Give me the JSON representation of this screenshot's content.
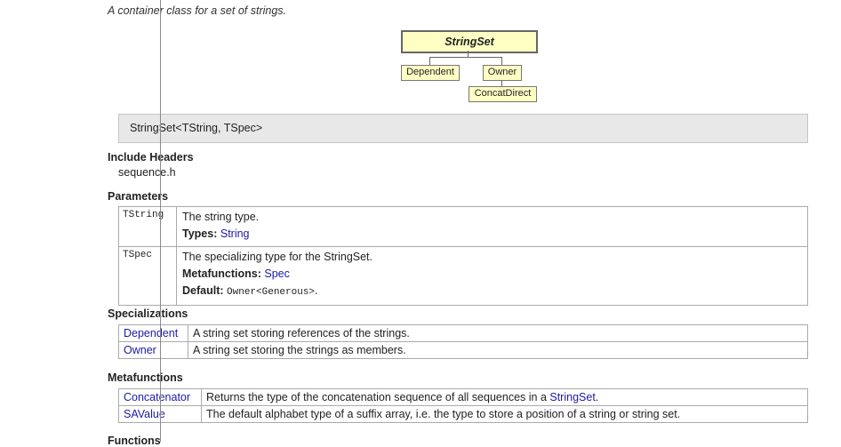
{
  "summary": "A container class for a set of strings.",
  "diagram": {
    "main": "StringSet",
    "dependent": "Dependent",
    "owner": "Owner",
    "concat": "ConcatDirect"
  },
  "signature": "StringSet<TString, TSpec>",
  "include": {
    "heading": "Include Headers",
    "file": "sequence.h"
  },
  "parameters": {
    "heading": "Parameters",
    "rows": [
      {
        "name": "TString",
        "desc": "The string type.",
        "l2_label": "Types:",
        "l2_value": "String"
      },
      {
        "name": "TSpec",
        "desc": "The specializing type for the StringSet.",
        "l2_label": "Metafunctions:",
        "l2_value": "Spec",
        "l3_label": "Default:",
        "l3_value": "Owner<Generous>",
        "l3_suffix": "."
      }
    ]
  },
  "specializations": {
    "heading": "Specializations",
    "rows": [
      {
        "name": "Dependent",
        "desc": "A string set storing references of the strings."
      },
      {
        "name": "Owner",
        "desc": "A string set storing the strings as members."
      }
    ]
  },
  "metafunctions": {
    "heading": "Metafunctions",
    "rows": [
      {
        "name": "Concatenator",
        "desc_prefix": "Returns the type of the concatenation sequence of all sequences in a ",
        "desc_link": "StringSet",
        "desc_suffix": "."
      },
      {
        "name": "SAValue",
        "desc": "The default alphabet type of a suffix array, i.e. the type to store a position of a string or string set."
      }
    ]
  },
  "functions": {
    "heading": "Functions"
  }
}
